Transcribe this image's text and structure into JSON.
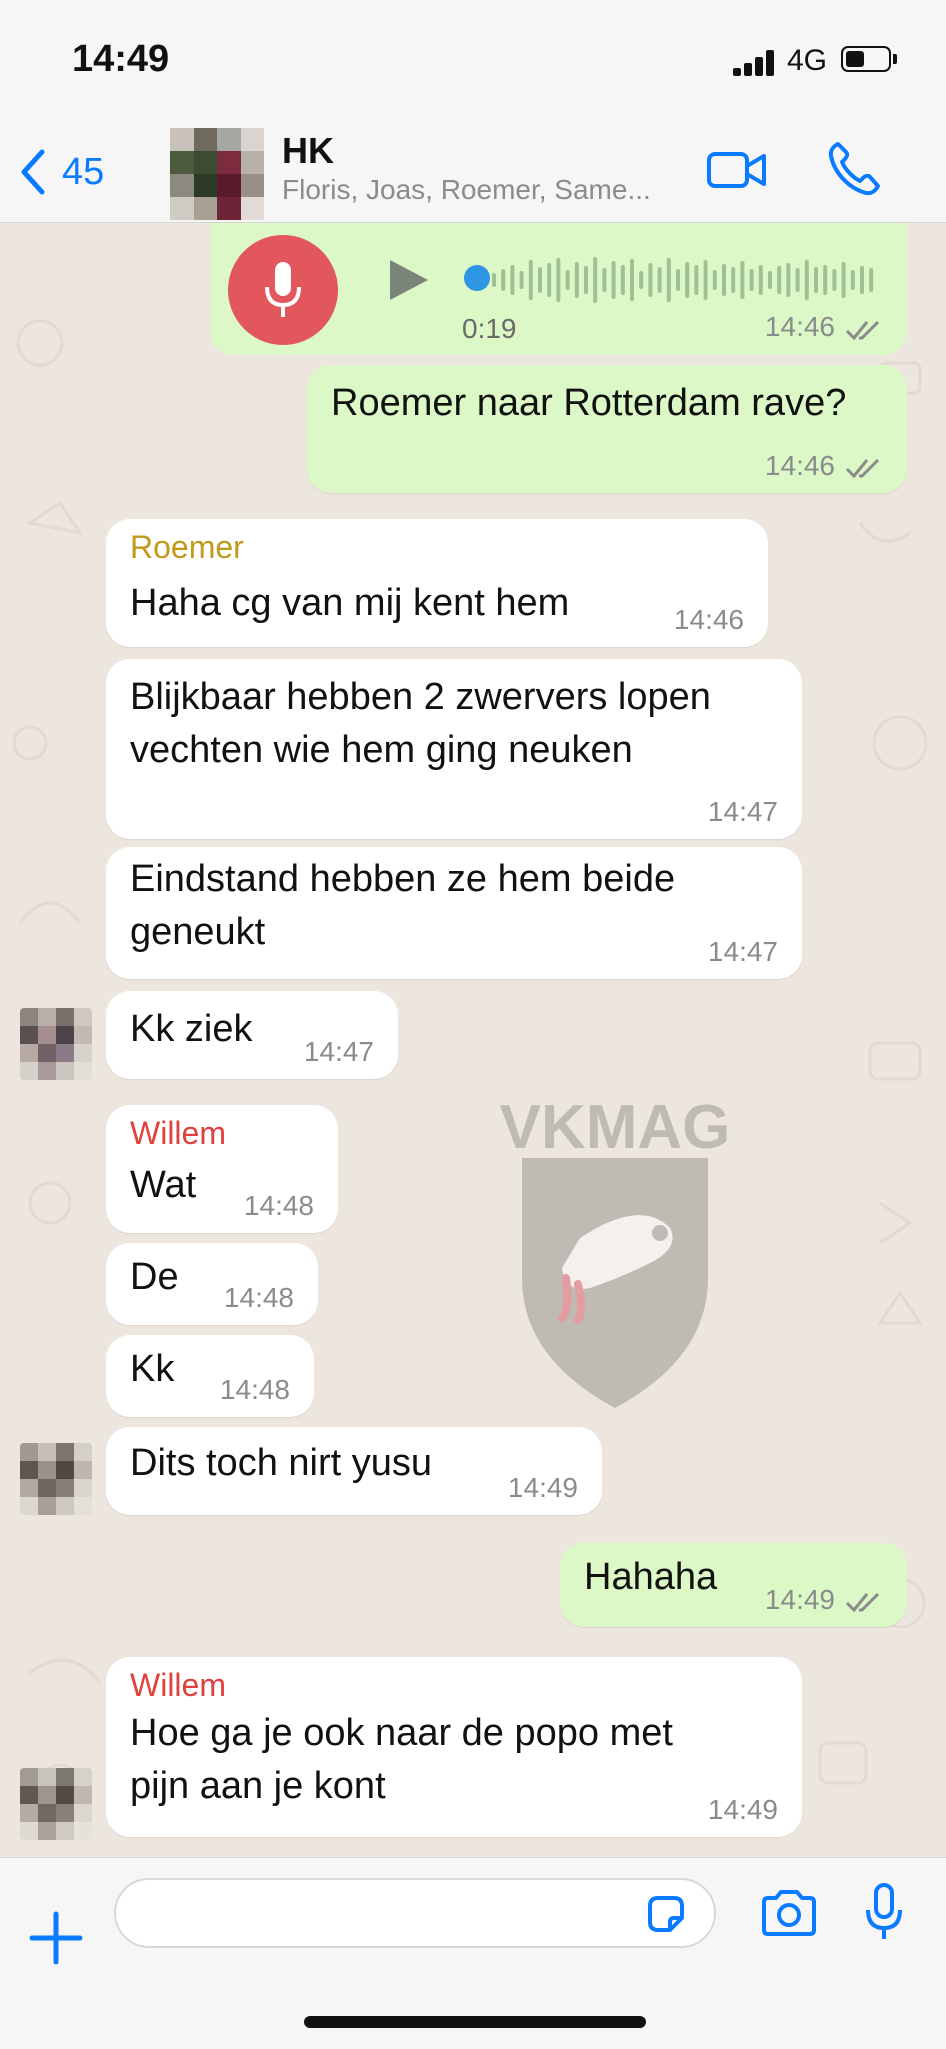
{
  "status_bar": {
    "time": "14:49",
    "network": "4G",
    "battery_percent": 45
  },
  "header": {
    "back_count": "45",
    "title": "HK",
    "members": "Floris, Joas, Roemer, Same..."
  },
  "voice_message": {
    "duration": "0:19",
    "time": "14:46",
    "progress": 0.0
  },
  "messages": [
    {
      "dir": "out",
      "text": "Roemer naar Rotterdam rave?",
      "time": "14:46"
    },
    {
      "dir": "in",
      "sender": "Roemer",
      "sender_color": "#c19a1c",
      "text": "Haha cg van mij kent hem",
      "time": "14:46"
    },
    {
      "dir": "in",
      "text_lines": [
        "Blijkbaar hebben 2 zwervers lopen",
        "vechten wie hem ging neuken"
      ],
      "time": "14:47"
    },
    {
      "dir": "in",
      "text_lines": [
        "Eindstand hebben ze hem beide",
        "geneukt"
      ],
      "time": "14:47"
    },
    {
      "dir": "in",
      "text": "Kk ziek",
      "time": "14:47"
    },
    {
      "dir": "in",
      "sender": "Willem",
      "sender_color": "#e0413d",
      "text": "Wat",
      "time": "14:48"
    },
    {
      "dir": "in",
      "text": "De",
      "time": "14:48"
    },
    {
      "dir": "in",
      "text": "Kk",
      "time": "14:48"
    },
    {
      "dir": "in",
      "text": "Dits toch nirt yusu",
      "time": "14:49"
    },
    {
      "dir": "out",
      "text": "Hahaha",
      "time": "14:49"
    },
    {
      "dir": "in",
      "sender": "Willem",
      "sender_color": "#e0413d",
      "text_lines": [
        "Hoe ga je ook naar de popo met",
        "pijn aan je kont"
      ],
      "time": "14:49"
    }
  ],
  "watermark": {
    "text": "VKMAG"
  },
  "input": {
    "value": "",
    "placeholder": ""
  },
  "colors": {
    "accent": "#0a7aff",
    "outgoing": "#dcf8c6",
    "incoming": "#ffffff",
    "background": "#ece5dd"
  },
  "icons": [
    "chevron-left-icon",
    "video-camera-icon",
    "phone-icon",
    "microphone-icon",
    "play-icon",
    "double-check-icon",
    "plus-icon",
    "sticker-icon",
    "camera-icon"
  ]
}
